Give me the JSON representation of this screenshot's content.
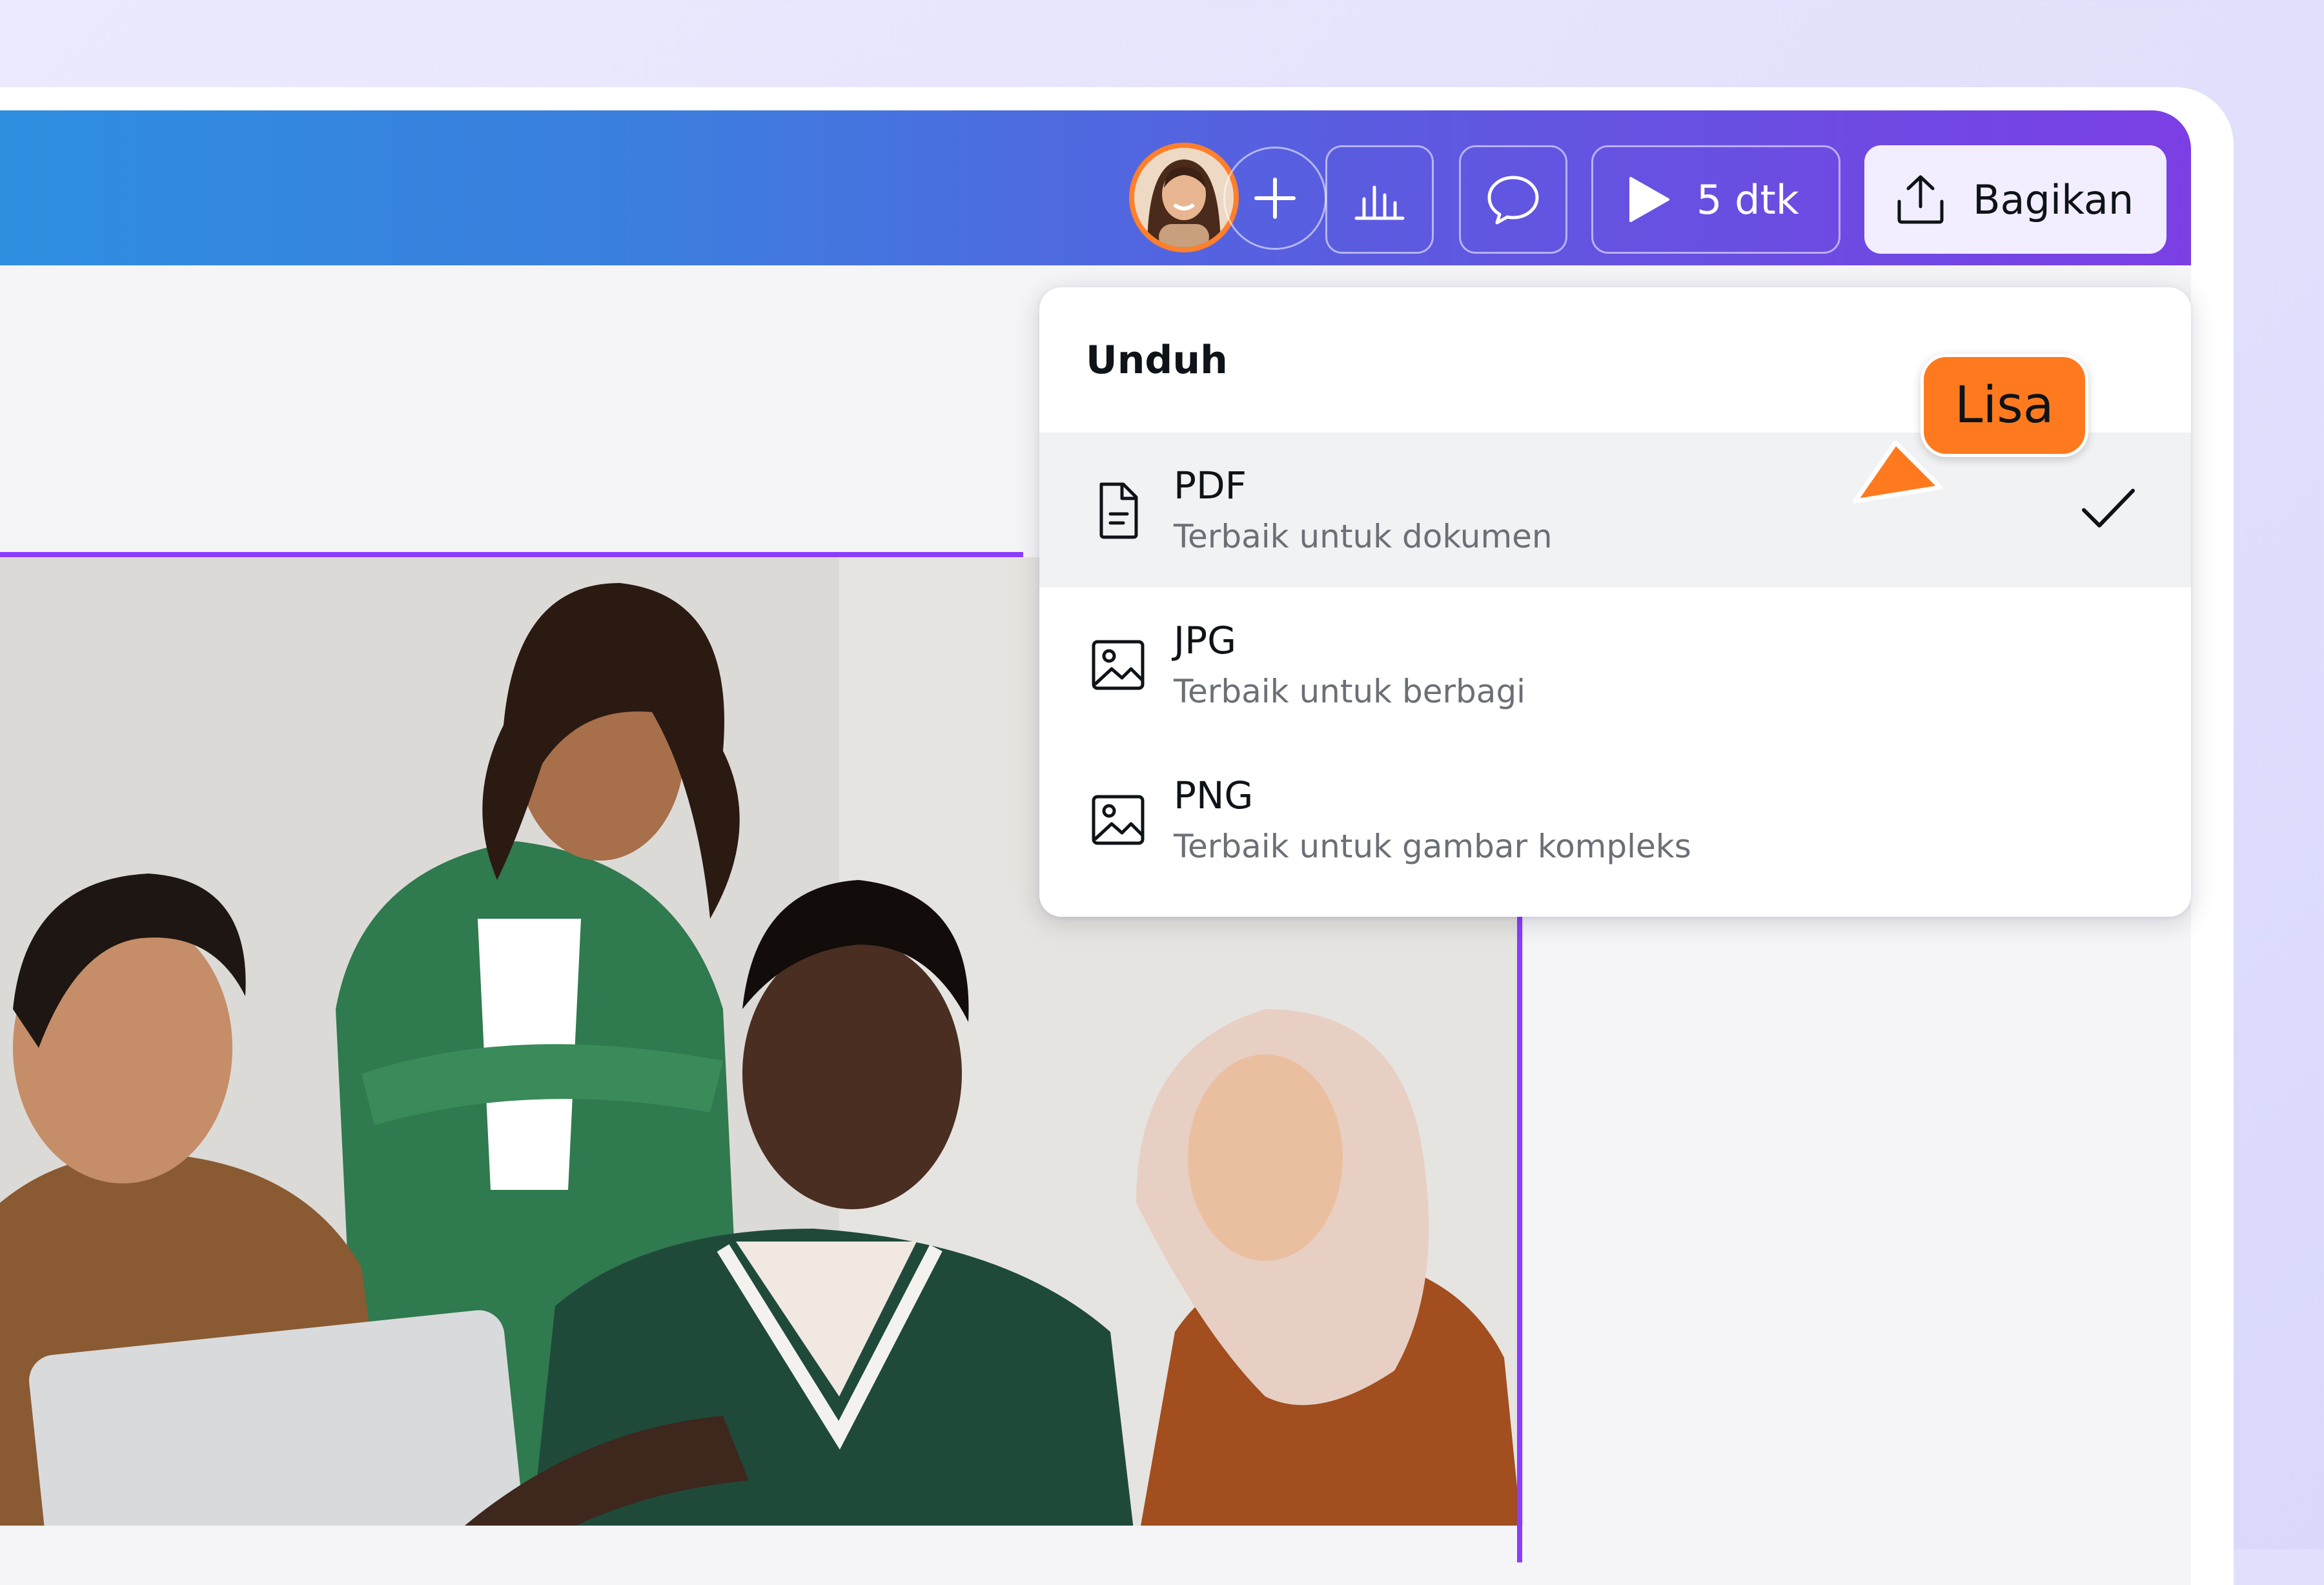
{
  "toolbar": {
    "avatar_alt": "Collaborator avatar",
    "add_icon": "plus-icon",
    "insights_icon": "bar-chart-icon",
    "comment_icon": "comment-icon",
    "play_icon": "play-icon",
    "play_label": "5 dtk",
    "share_icon": "upload-icon",
    "share_label": "Bagikan"
  },
  "download_menu": {
    "title": "Unduh",
    "items": [
      {
        "format": "PDF",
        "description": "Terbaik untuk dokumen",
        "icon": "document-icon",
        "selected": true
      },
      {
        "format": "JPG",
        "description": "Terbaik untuk berbagi",
        "icon": "image-icon",
        "selected": false
      },
      {
        "format": "PNG",
        "description": "Terbaik untuk gambar kompleks",
        "icon": "image-icon",
        "selected": false
      }
    ]
  },
  "collaborator_cursor": {
    "name": "Lisa",
    "color": "#FF7A1F"
  },
  "colors": {
    "selection": "#8B3DFF",
    "avatar_ring": "#FF7F2A"
  }
}
